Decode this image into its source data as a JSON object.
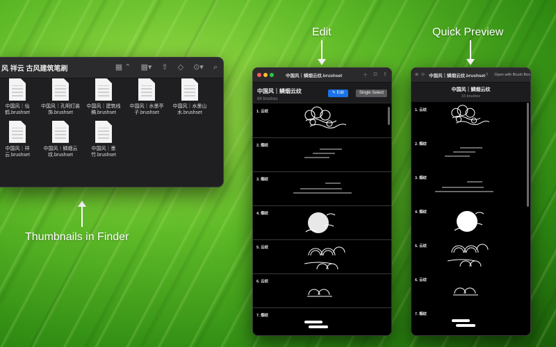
{
  "callouts": {
    "edit": "Edit",
    "quick_preview": "Quick Preview",
    "thumbnails": "Thumbnails in Finder"
  },
  "finder": {
    "title": "风 祥云 古风建筑笔刷",
    "toolbar_icons": [
      "view-grid-icon",
      "group-icon",
      "share-icon",
      "tag-icon",
      "more-icon",
      "search-icon"
    ],
    "files": [
      {
        "name": "中国风｜仙鹤.brushset"
      },
      {
        "name": "中国风｜孔明灯装饰.brushset"
      },
      {
        "name": "中国风｜建筑线稿.brushset"
      },
      {
        "name": "中国风｜水墨亭子.brushset"
      },
      {
        "name": "中国风｜水墨山水.brushset"
      },
      {
        "name": "中国风｜祥云.brushset"
      },
      {
        "name": "中国风｜鳞烟云纹.brushset"
      },
      {
        "name": "中国风｜墨竹.brushset"
      }
    ]
  },
  "edit_window": {
    "title": "中国风｜鳞烟云纹.brushset",
    "header_title": "中国风｜鳞烟云纹",
    "brush_count": "84 brushes",
    "edit_label": "✎ Edit",
    "single_select_label": "Single Select",
    "brushes": [
      {
        "label": "1. 云纹"
      },
      {
        "label": "2. 烟纹"
      },
      {
        "label": "3. 烟纹"
      },
      {
        "label": "4. 烟纹"
      },
      {
        "label": "5. 云纹"
      },
      {
        "label": "6. 云纹"
      },
      {
        "label": "7. 烟纹"
      }
    ]
  },
  "preview_window": {
    "title": "中国风｜鳞烟云纹.brushset",
    "open_with": "Open with Brush Box",
    "header_title": "中国风｜鳞烟云纹",
    "brush_count": "15 brushes",
    "brushes": [
      {
        "label": "1. 云纹"
      },
      {
        "label": "2. 烟纹"
      },
      {
        "label": "3. 烟纹"
      },
      {
        "label": "4. 烟纹"
      },
      {
        "label": "5. 云纹"
      },
      {
        "label": "6. 云纹"
      },
      {
        "label": "7. 烟纹"
      }
    ]
  },
  "colors": {
    "accent_blue": "#1a73e8",
    "close": "#ff5f57",
    "minimize": "#febc2e",
    "zoom": "#28c840"
  }
}
